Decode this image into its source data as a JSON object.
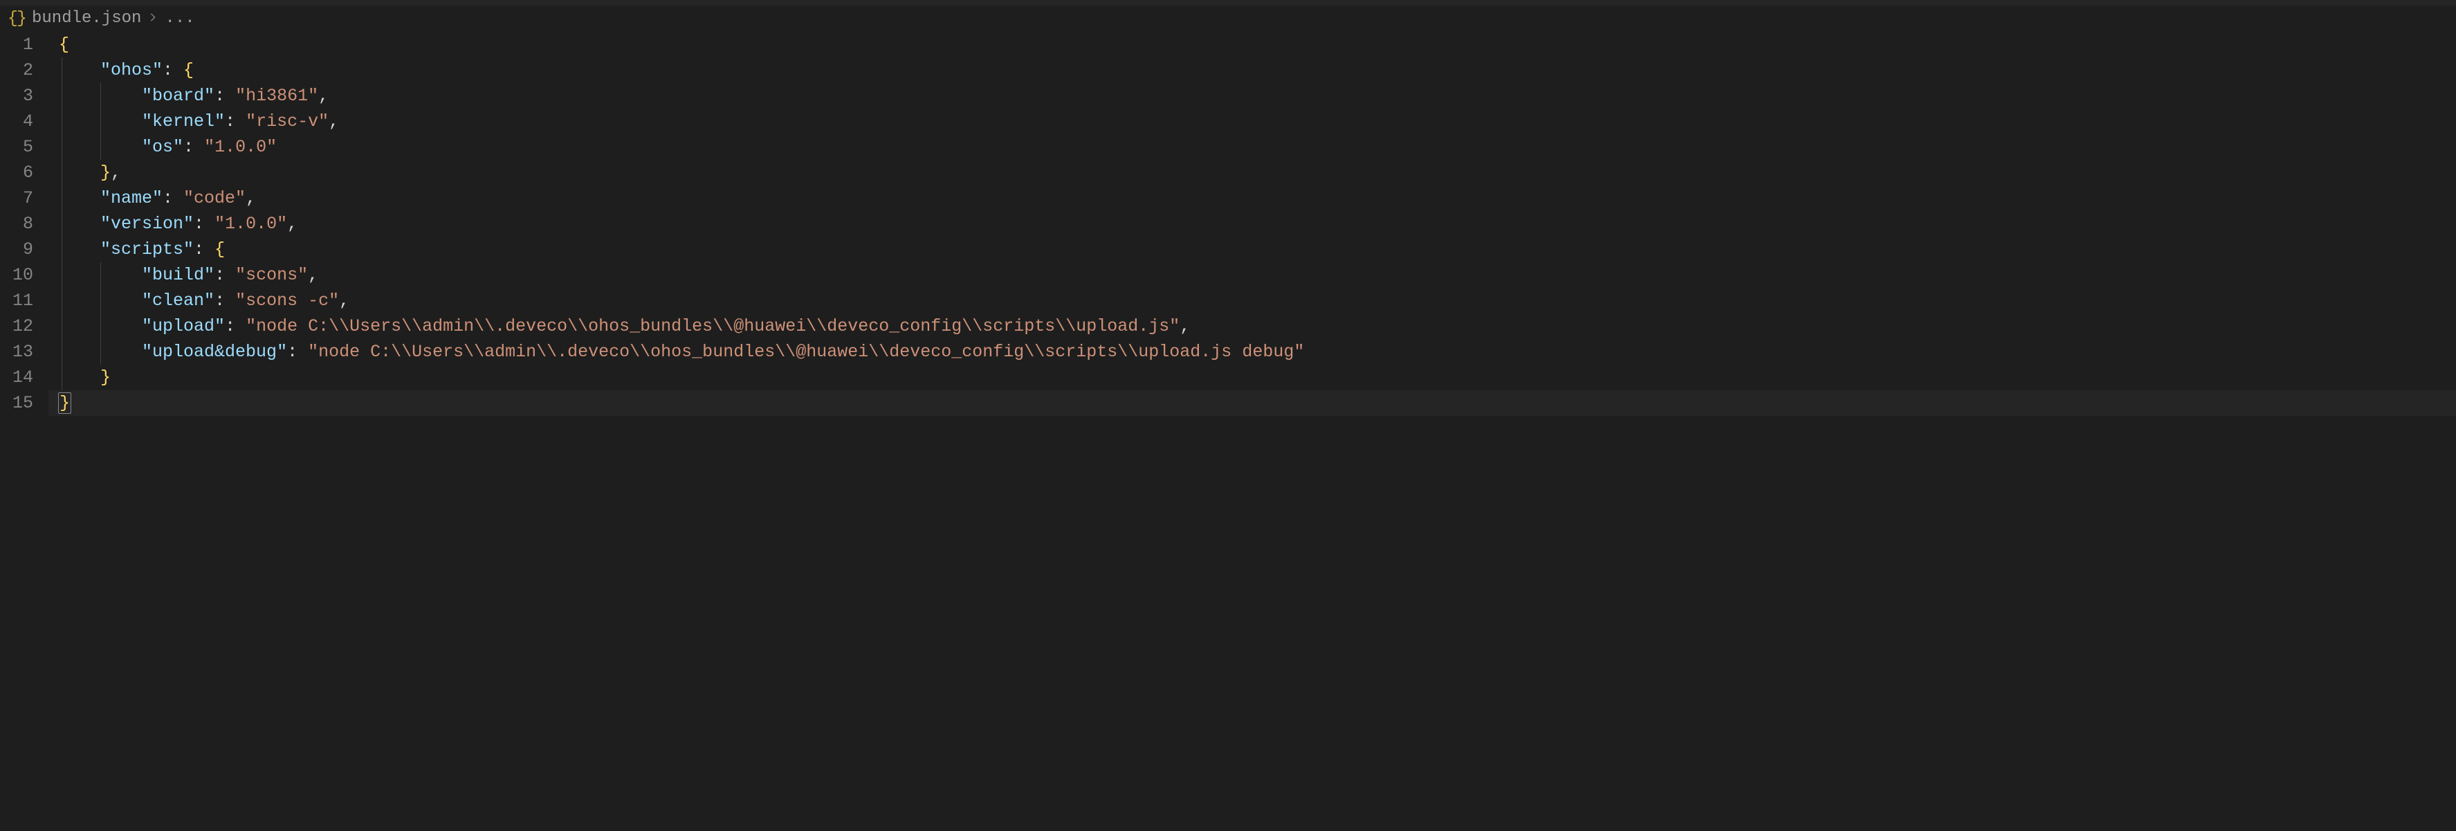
{
  "breadcrumb": {
    "file_icon": "{}",
    "file_name": "bundle.json",
    "ellipsis": "..."
  },
  "code": {
    "lines": [
      {
        "num": "1",
        "indent": 0,
        "tokens": [
          {
            "t": "punct",
            "v": "{"
          }
        ]
      },
      {
        "num": "2",
        "indent": 1,
        "tokens": [
          {
            "t": "key",
            "v": "\"ohos\""
          },
          {
            "t": "ppunct",
            "v": ": "
          },
          {
            "t": "punct",
            "v": "{"
          }
        ]
      },
      {
        "num": "3",
        "indent": 2,
        "tokens": [
          {
            "t": "key",
            "v": "\"board\""
          },
          {
            "t": "ppunct",
            "v": ": "
          },
          {
            "t": "str",
            "v": "\"hi3861\""
          },
          {
            "t": "ppunct",
            "v": ","
          }
        ]
      },
      {
        "num": "4",
        "indent": 2,
        "tokens": [
          {
            "t": "key",
            "v": "\"kernel\""
          },
          {
            "t": "ppunct",
            "v": ": "
          },
          {
            "t": "str",
            "v": "\"risc-v\""
          },
          {
            "t": "ppunct",
            "v": ","
          }
        ]
      },
      {
        "num": "5",
        "indent": 2,
        "tokens": [
          {
            "t": "key",
            "v": "\"os\""
          },
          {
            "t": "ppunct",
            "v": ": "
          },
          {
            "t": "str",
            "v": "\"1.0.0\""
          }
        ]
      },
      {
        "num": "6",
        "indent": 1,
        "tokens": [
          {
            "t": "punct",
            "v": "}"
          },
          {
            "t": "ppunct",
            "v": ","
          }
        ]
      },
      {
        "num": "7",
        "indent": 1,
        "tokens": [
          {
            "t": "key",
            "v": "\"name\""
          },
          {
            "t": "ppunct",
            "v": ": "
          },
          {
            "t": "str",
            "v": "\"code\""
          },
          {
            "t": "ppunct",
            "v": ","
          }
        ]
      },
      {
        "num": "8",
        "indent": 1,
        "tokens": [
          {
            "t": "key",
            "v": "\"version\""
          },
          {
            "t": "ppunct",
            "v": ": "
          },
          {
            "t": "str",
            "v": "\"1.0.0\""
          },
          {
            "t": "ppunct",
            "v": ","
          }
        ]
      },
      {
        "num": "9",
        "indent": 1,
        "tokens": [
          {
            "t": "key",
            "v": "\"scripts\""
          },
          {
            "t": "ppunct",
            "v": ": "
          },
          {
            "t": "punct",
            "v": "{"
          }
        ]
      },
      {
        "num": "10",
        "indent": 2,
        "tokens": [
          {
            "t": "key",
            "v": "\"build\""
          },
          {
            "t": "ppunct",
            "v": ": "
          },
          {
            "t": "str",
            "v": "\"scons\""
          },
          {
            "t": "ppunct",
            "v": ","
          }
        ]
      },
      {
        "num": "11",
        "indent": 2,
        "tokens": [
          {
            "t": "key",
            "v": "\"clean\""
          },
          {
            "t": "ppunct",
            "v": ": "
          },
          {
            "t": "str",
            "v": "\"scons -c\""
          },
          {
            "t": "ppunct",
            "v": ","
          }
        ]
      },
      {
        "num": "12",
        "indent": 2,
        "tokens": [
          {
            "t": "key",
            "v": "\"upload\""
          },
          {
            "t": "ppunct",
            "v": ": "
          },
          {
            "t": "str",
            "v": "\"node C:\\\\Users\\\\admin\\\\.deveco\\\\ohos_bundles\\\\@huawei\\\\deveco_config\\\\scripts\\\\upload.js\""
          },
          {
            "t": "ppunct",
            "v": ","
          }
        ]
      },
      {
        "num": "13",
        "indent": 2,
        "tokens": [
          {
            "t": "key",
            "v": "\"upload&debug\""
          },
          {
            "t": "ppunct",
            "v": ": "
          },
          {
            "t": "str",
            "v": "\"node C:\\\\Users\\\\admin\\\\.deveco\\\\ohos_bundles\\\\@huawei\\\\deveco_config\\\\scripts\\\\upload.js debug\""
          }
        ]
      },
      {
        "num": "14",
        "indent": 1,
        "tokens": [
          {
            "t": "punct",
            "v": "}"
          }
        ]
      },
      {
        "num": "15",
        "indent": 0,
        "tokens": [
          {
            "t": "punct",
            "v": "}",
            "match": true
          }
        ],
        "cursor": true
      }
    ]
  },
  "json_content": {
    "ohos": {
      "board": "hi3861",
      "kernel": "risc-v",
      "os": "1.0.0"
    },
    "name": "code",
    "version": "1.0.0",
    "scripts": {
      "build": "scons",
      "clean": "scons -c",
      "upload": "node C:\\Users\\admin\\.deveco\\ohos_bundles\\@huawei\\deveco_config\\scripts\\upload.js",
      "upload&debug": "node C:\\Users\\admin\\.deveco\\ohos_bundles\\@huawei\\deveco_config\\scripts\\upload.js debug"
    }
  }
}
